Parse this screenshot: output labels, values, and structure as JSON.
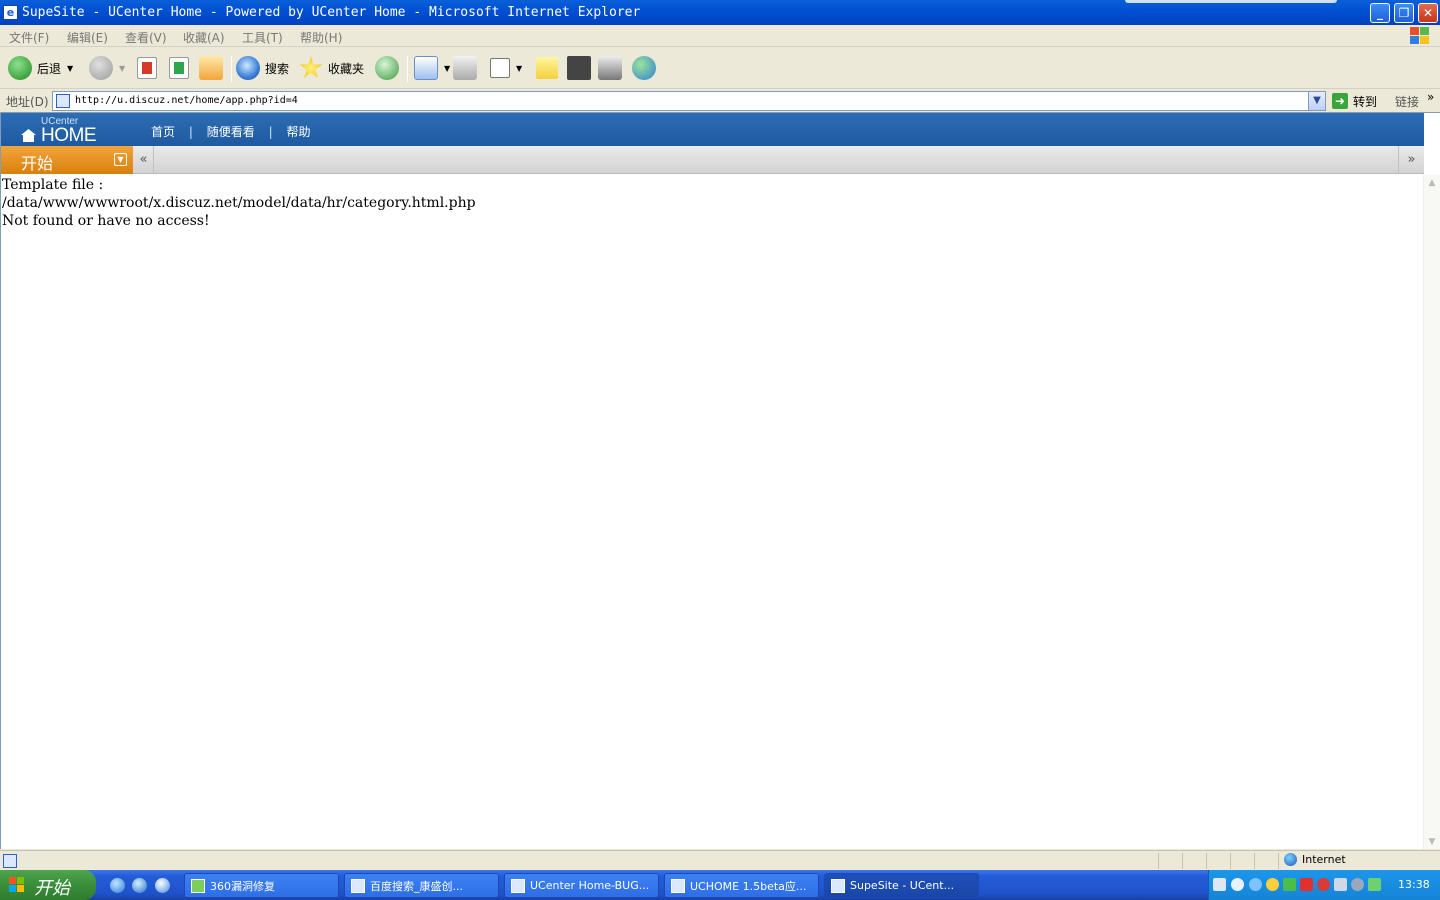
{
  "window": {
    "title": "SupeSite - UCenter Home - Powered by UCenter Home - Microsoft Internet Explorer",
    "buttons": {
      "minimize": "_",
      "restore": "❐",
      "close": "✕"
    }
  },
  "menubar": {
    "items": [
      "文件(F)",
      "编辑(E)",
      "查看(V)",
      "收藏(A)",
      "工具(T)",
      "帮助(H)"
    ]
  },
  "toolbar": {
    "back_label": "后退",
    "search_label": "搜索",
    "favorites_label": "收藏夹"
  },
  "address": {
    "label": "地址(D)",
    "url": "http://u.discuz.net/home/app.php?id=4",
    "go_label": "转到",
    "links_label": "链接",
    "links_chevron": "»"
  },
  "uchome": {
    "logo_small": "UCenter",
    "logo_big": "HOME",
    "nav": [
      "首页",
      "随便看看",
      "帮助"
    ],
    "nav_separator": "|",
    "start_label": "开始",
    "collapse_left": "«",
    "collapse_right": "»"
  },
  "content": {
    "lines": [
      "Template file :",
      "/data/www/wwwroot/x.discuz.net/model/data/hr/category.html.php",
      "Not found or have no access!"
    ]
  },
  "statusbar": {
    "zone_label": "Internet"
  },
  "taskbar": {
    "start_label": "开始",
    "tasks": [
      "360漏洞修复",
      "百度搜索_康盛创...",
      "UCenter Home-BUG...",
      "UCHOME 1.5beta应...",
      "SupeSite - UCent..."
    ],
    "clock": "13:38"
  },
  "colors": {
    "title_bar": "#0151d3",
    "uchome_header": "#1e5aa1",
    "start_orange": "#e08a1a",
    "taskbar_blue": "#245dd7",
    "start_green": "#3a8e3a"
  }
}
